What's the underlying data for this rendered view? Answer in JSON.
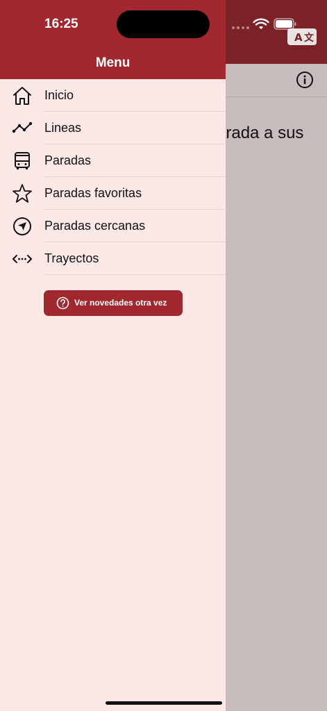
{
  "status_bar": {
    "time": "16:25"
  },
  "drawer": {
    "title": "Menu",
    "items": [
      {
        "label": "Inicio",
        "icon": "home-icon"
      },
      {
        "label": "Lineas",
        "icon": "line-route-icon"
      },
      {
        "label": "Paradas",
        "icon": "bus-icon"
      },
      {
        "label": "Paradas favoritas",
        "icon": "star-icon"
      },
      {
        "label": "Paradas cercanas",
        "icon": "location-arrow-icon"
      },
      {
        "label": "Trayectos",
        "icon": "route-arrows-icon"
      }
    ],
    "news_button": {
      "label": "Ver novedades otra vez",
      "icon": "question-circle-icon"
    }
  },
  "background": {
    "text": "arada a sus"
  },
  "colors": {
    "primary": "#a0282e",
    "drawer_bg": "#fbe8e7",
    "scrim": "#c9bcbc"
  }
}
